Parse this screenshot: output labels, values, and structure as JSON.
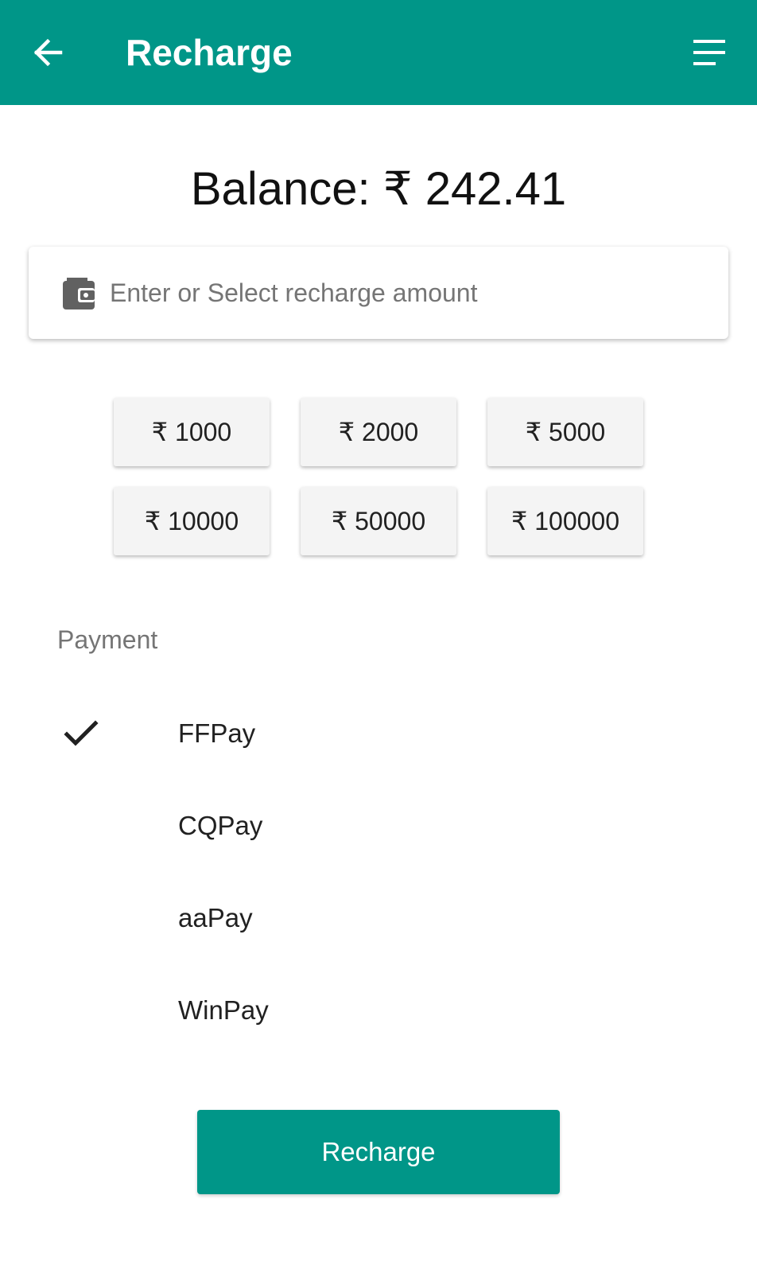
{
  "header": {
    "title": "Recharge",
    "back_icon": "arrow-left-icon",
    "menu_icon": "menu-icon",
    "background": "#009688"
  },
  "balance": {
    "text": "Balance: ₹ 242.41"
  },
  "amount_field": {
    "icon": "wallet-icon",
    "placeholder": "Enter or Select recharge amount",
    "value": ""
  },
  "amount_chips": [
    {
      "label": "₹ 1000"
    },
    {
      "label": "₹ 2000"
    },
    {
      "label": "₹ 5000"
    },
    {
      "label": "₹ 10000"
    },
    {
      "label": "₹ 50000"
    },
    {
      "label": "₹ 100000"
    }
  ],
  "payment": {
    "label": "Payment",
    "options": [
      {
        "name": "FFPay",
        "selected": true
      },
      {
        "name": "CQPay",
        "selected": false
      },
      {
        "name": "aaPay",
        "selected": false
      },
      {
        "name": "WinPay",
        "selected": false
      }
    ]
  },
  "actions": {
    "recharge_label": "Recharge",
    "accent": "#009688"
  }
}
